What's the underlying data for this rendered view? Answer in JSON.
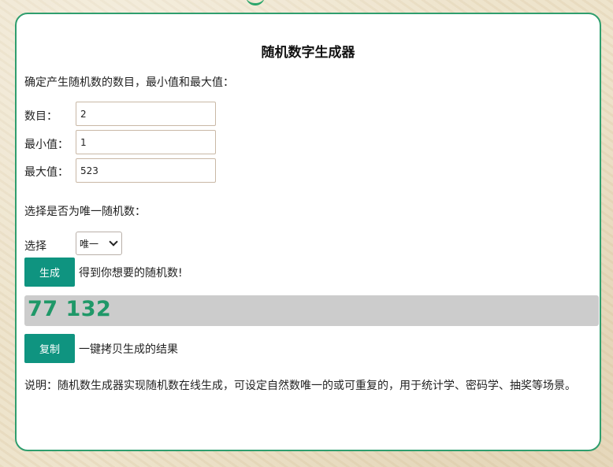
{
  "title": "随机数字生成器",
  "intro": "确定产生随机数的数目，最小值和最大值：",
  "fields": {
    "count": {
      "label": "数目：",
      "value": "2"
    },
    "min": {
      "label": "最小值：",
      "value": "1"
    },
    "max": {
      "label": "最大值：",
      "value": "523"
    }
  },
  "unique_prompt": "选择是否为唯一随机数：",
  "select": {
    "label": "选择",
    "selected": "唯一"
  },
  "generate": {
    "button": "生成",
    "caption": "得到你想要的随机数!"
  },
  "result": "77 132",
  "copy": {
    "button": "复制",
    "caption": "一键拷贝生成的结果"
  },
  "description": "说明：随机数生成器实现随机数在线生成，可设定自然数唯一的或可重复的，用于统计学、密码学、抽奖等场景。",
  "colors": {
    "accent_button": "#0f9480",
    "card_border": "#2f9e6e",
    "result_text": "#1f9868",
    "result_background": "#cccccc"
  },
  "icons": {
    "select_arrow": "chevron-down-icon"
  }
}
